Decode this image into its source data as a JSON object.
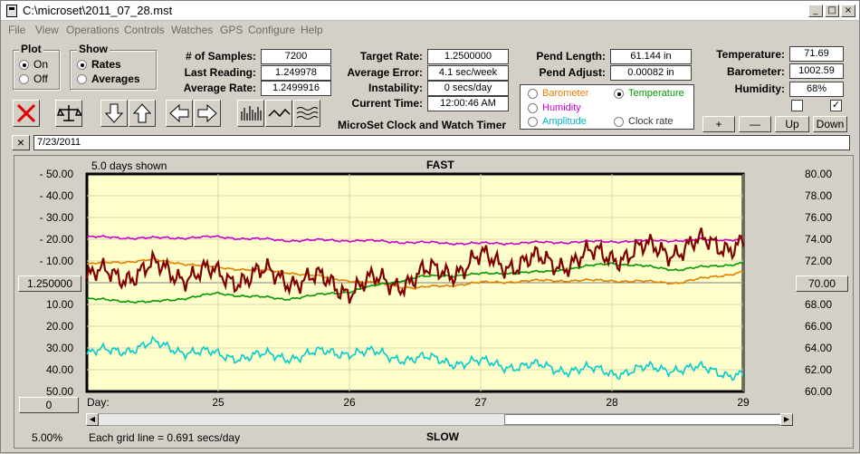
{
  "window": {
    "title": "C:\\microset\\2011_07_28.mst",
    "min": "_",
    "max": "□",
    "close": "×"
  },
  "menu": [
    "File",
    "View",
    "Operations",
    "Controls",
    "Watches",
    "GPS",
    "Configure",
    "Help"
  ],
  "plot_group": {
    "label": "Plot",
    "on": "On",
    "off": "Off"
  },
  "show_group": {
    "label": "Show",
    "rates": "Rates",
    "averages": "Averages"
  },
  "stats": {
    "samples_label": "# of Samples:",
    "samples": "7200",
    "last_label": "Last Reading:",
    "last": "1.249978",
    "avg_label": "Average Rate:",
    "avg": "1.2499916",
    "target_label": "Target Rate:",
    "target": "1.2500000",
    "avgerr_label": "Average Error:",
    "avgerr": "4.1 sec/week",
    "instab_label": "Instability:",
    "instab": "0 secs/day",
    "time_label": "Current Time:",
    "time": "12:00:46 AM",
    "pendlen_label": "Pend Length:",
    "pendlen": "61.144 in",
    "pendadj_label": "Pend Adjust:",
    "pendadj": "0.00082 in",
    "temp_label": "Temperature:",
    "temp": "71.69",
    "baro_label": "Barometer:",
    "baro": "1002.59",
    "hum_label": "Humidity:",
    "hum": "68%"
  },
  "app_subtitle": "MicroSet Clock and Watch Timer",
  "sensors": {
    "barometer": "Barometer",
    "temperature": "Temperature",
    "humidity": "Humidity",
    "amplitude": "Amplitude",
    "clockrate": "Clock rate"
  },
  "colors": {
    "barometer": "#e08000",
    "temperature": "#009900",
    "humidity": "#cc00cc",
    "amplitude": "#00cccc",
    "rate": "#800000",
    "plotbg": "#ffffcc"
  },
  "pbtns": {
    "plus": "+",
    "minus": "—",
    "up": "Up",
    "down": "Down"
  },
  "notes": {
    "close": "×",
    "text": "7/23/2011"
  },
  "chart_info": {
    "days_shown": "5.0 days shown",
    "top": "FAST",
    "bottom": "SLOW",
    "center_left": "1.250000",
    "center_right": "70.00",
    "zero": "0",
    "percent": "5.00%",
    "gridnote": "Each grid line = 0.691 secs/day",
    "day_label": "Day:"
  },
  "chart_data": {
    "type": "line",
    "xlim": [
      24,
      29
    ],
    "x_ticks": [
      "25",
      "26",
      "27",
      "28",
      "29"
    ],
    "left_ticks": [
      "- 50.00",
      "- 40.00",
      "- 30.00",
      "- 20.00",
      "- 10.00",
      "",
      "10.00",
      "20.00",
      "30.00",
      "40.00",
      "50.00"
    ],
    "right_ticks": [
      "80.00",
      "78.00",
      "76.00",
      "74.00",
      "72.00",
      "",
      "68.00",
      "66.00",
      "64.00",
      "62.00",
      "60.00"
    ],
    "ylim_right": [
      60,
      80
    ],
    "series": [
      {
        "name": "Humidity",
        "color": "#cc00cc",
        "x": [
          24,
          24.5,
          25,
          25.5,
          26,
          26.5,
          27,
          27.5,
          28,
          28.5,
          29
        ],
        "values": [
          74.2,
          74.1,
          74.2,
          73.9,
          73.9,
          73.7,
          73.6,
          73.7,
          73.8,
          73.9,
          74.0
        ]
      },
      {
        "name": "Barometer",
        "color": "#e08000",
        "x": [
          24,
          24.5,
          25,
          25.5,
          26,
          26.5,
          27,
          27.5,
          28,
          28.5,
          29
        ],
        "values": [
          71.7,
          72.1,
          71.4,
          71.0,
          70.2,
          69.5,
          70.0,
          70.2,
          70.2,
          70.0,
          71.0
        ]
      },
      {
        "name": "Temperature",
        "color": "#009900",
        "x": [
          24,
          24.5,
          25,
          25.5,
          26,
          26.5,
          27,
          27.5,
          28,
          28.5,
          29
        ],
        "values": [
          68.5,
          68.2,
          69.0,
          68.5,
          69.2,
          70.5,
          70.8,
          71.0,
          71.8,
          71.2,
          71.8
        ]
      },
      {
        "name": "Clock rate",
        "color": "#800000",
        "x": [
          24,
          24.5,
          25,
          25.5,
          26,
          26.5,
          27,
          27.5,
          28,
          28.5,
          29
        ],
        "values": [
          70.4,
          71.2,
          70.6,
          70.6,
          69.6,
          70.4,
          72.0,
          71.8,
          72.6,
          73.2,
          73.8
        ]
      },
      {
        "name": "Amplitude",
        "color": "#00cccc",
        "x": [
          24,
          24.5,
          25,
          25.5,
          26,
          26.5,
          27,
          27.5,
          28,
          28.5,
          29
        ],
        "values": [
          63.4,
          64.3,
          63.3,
          63.2,
          63.7,
          63.0,
          62.6,
          62.2,
          61.8,
          62.2,
          61.6
        ]
      }
    ]
  }
}
